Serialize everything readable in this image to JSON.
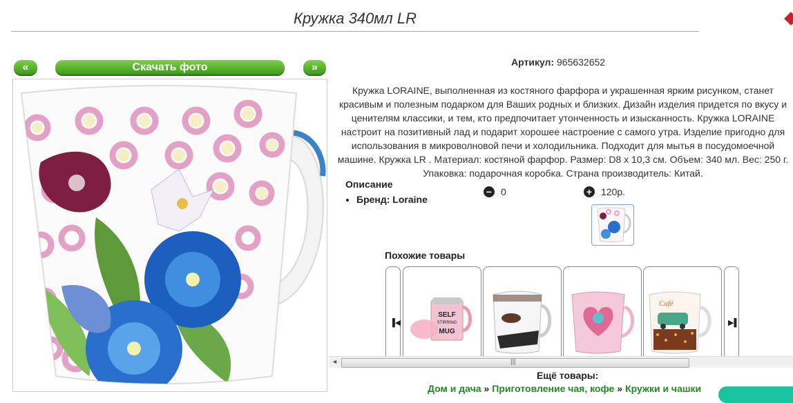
{
  "page": {
    "title": "Кружка 340мл LR"
  },
  "gallery": {
    "prev_label": "«",
    "download_label": "Скачать фото",
    "next_label": "»"
  },
  "product": {
    "article_label": "Артикул:",
    "article_value": "965632652",
    "description": "Кружка LORAINE, выполненная из костяного фарфора и украшенная ярким рисунком, станет красивым и полезным подарком для Ваших родных и близких. Дизайн изделия придется по вкусу и ценителям классики, и тем, кто предпочитает утонченность и изысканность. Кружка LORAINE настроит на позитивный лад и подарит хорошее настроение с самого утра. Изделие пригодно для использования в микроволновой печи и холодильника. Подходит для мытья в посудомоечной машине. Кружка LR . Материал: костяной фарфор. Размер: D8 х 10,3 см. Объем: 340 мл. Вес: 250 г. Упаковка: подарочная коробка. Страна производитель: Китай.",
    "attributes_heading": "Описание",
    "brand_item": "Бренд: Loraine"
  },
  "cart": {
    "minus_icon": "minus-circle-icon",
    "quantity": "0",
    "plus_icon": "plus-circle-icon",
    "price": "120р."
  },
  "similar": {
    "heading": "Похожие товары",
    "left_icon": "carousel-prev-icon",
    "right_icon": "carousel-next-icon",
    "items": [
      {
        "image": "self-stirring-mug-photo",
        "mug_text_1": "SELF",
        "mug_text_2": "STIRRING",
        "mug_text_3": "MUG"
      },
      {
        "image": "coffee-beans-mug-photo"
      },
      {
        "image": "pink-heart-mug-photo"
      },
      {
        "image": "cafe-car-mug-photo",
        "mug_text_1": "Café"
      }
    ]
  },
  "more": {
    "heading": "Ещё товары:",
    "breadcrumbs": [
      "Дом и дача",
      "Приготовление чая, кофе",
      "Кружки и чашки"
    ],
    "separator": "»"
  },
  "scrollbar": {
    "left_arrow": "◄",
    "grip": "|||"
  },
  "colors": {
    "button_green": "#4caf25",
    "link_green": "#1f8a1f",
    "brand_red": "#c8202a"
  }
}
